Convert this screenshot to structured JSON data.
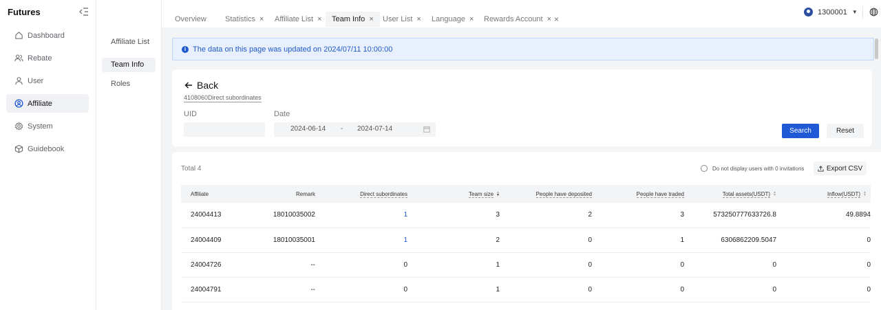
{
  "app": {
    "title": "Futures"
  },
  "sidebar": {
    "items": [
      {
        "label": "Dashboard",
        "icon": "home-icon"
      },
      {
        "label": "Rebate",
        "icon": "users-icon"
      },
      {
        "label": "User",
        "icon": "user-icon"
      },
      {
        "label": "Affiliate",
        "icon": "user-circle-icon",
        "active": true
      },
      {
        "label": "System",
        "icon": "gear-icon"
      },
      {
        "label": "Guidebook",
        "icon": "cube-icon"
      }
    ]
  },
  "subnav": {
    "items": [
      {
        "label": "Affiliate List"
      },
      {
        "label": "Team Info",
        "active": true
      },
      {
        "label": "Roles"
      }
    ]
  },
  "tabs": [
    {
      "label": "Overview",
      "closable": false
    },
    {
      "label": "Statistics",
      "closable": true
    },
    {
      "label": "Affiliate List",
      "closable": true
    },
    {
      "label": "Team Info",
      "closable": true,
      "active": true
    },
    {
      "label": "User List",
      "closable": true
    },
    {
      "label": "Language",
      "closable": true
    },
    {
      "label": "Rewards Account",
      "closable": true
    }
  ],
  "header": {
    "user": "1300001"
  },
  "notice": {
    "text": "The data on this page was updated on 2024/07/11 10:00:00"
  },
  "filter": {
    "back_label": "Back",
    "breadcrumb": "4108060Direct subordinates",
    "uid_label": "UID",
    "uid_value": "",
    "date_label": "Date",
    "date_start": "2024-06-14",
    "date_sep": "-",
    "date_end": "2024-07-14",
    "search_label": "Search",
    "reset_label": "Reset"
  },
  "table": {
    "total": "Total 4",
    "hide_zero_label": "Do not display users with 0 invitations",
    "export_label": "Export CSV",
    "columns": [
      "Affiliate",
      "Remark",
      "Direct subordinates",
      "Team size",
      "People have deposited",
      "People have traded",
      "Total assets(USDT)",
      "Inflow(USDT)"
    ],
    "rows": [
      {
        "affiliate": "24004413",
        "remark": "18010035002",
        "direct": "1",
        "team": "3",
        "deposited": "2",
        "traded": "3",
        "assets": "573250777633726.8",
        "inflow": "49.8894"
      },
      {
        "affiliate": "24004409",
        "remark": "18010035001",
        "direct": "1",
        "team": "2",
        "deposited": "0",
        "traded": "1",
        "assets": "6306862209.5047",
        "inflow": "0"
      },
      {
        "affiliate": "24004726",
        "remark": "--",
        "direct": "0",
        "team": "1",
        "deposited": "0",
        "traded": "0",
        "assets": "0",
        "inflow": "0"
      },
      {
        "affiliate": "24004791",
        "remark": "--",
        "direct": "0",
        "team": "1",
        "deposited": "0",
        "traded": "0",
        "assets": "0",
        "inflow": "0"
      }
    ]
  },
  "colors": {
    "primary": "#1f59d6",
    "notice_bg": "#e8f0fd",
    "page_bg": "#f3f4f6"
  }
}
